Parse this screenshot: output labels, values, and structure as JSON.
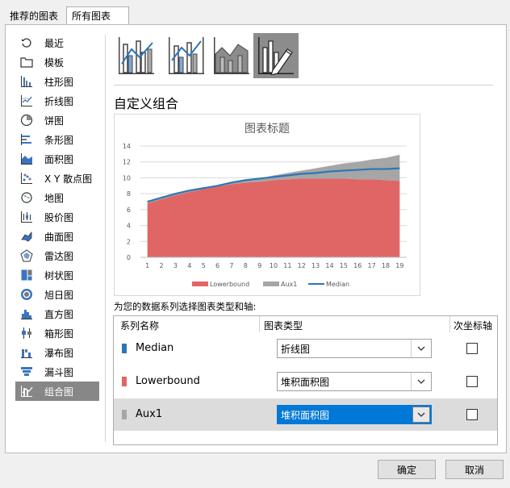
{
  "tabs": [
    {
      "label": "推荐的图表"
    },
    {
      "label": "所有图表"
    }
  ],
  "sidebar": {
    "items": [
      {
        "label": "最近",
        "icon": "recent-icon"
      },
      {
        "label": "模板",
        "icon": "folder-icon"
      },
      {
        "label": "柱形图",
        "icon": "column-chart-icon"
      },
      {
        "label": "折线图",
        "icon": "line-chart-icon"
      },
      {
        "label": "饼图",
        "icon": "pie-chart-icon"
      },
      {
        "label": "条形图",
        "icon": "bar-chart-icon"
      },
      {
        "label": "面积图",
        "icon": "area-chart-icon"
      },
      {
        "label": "X Y 散点图",
        "icon": "scatter-chart-icon"
      },
      {
        "label": "地图",
        "icon": "map-chart-icon"
      },
      {
        "label": "股价图",
        "icon": "stock-chart-icon"
      },
      {
        "label": "曲面图",
        "icon": "surface-chart-icon"
      },
      {
        "label": "雷达图",
        "icon": "radar-chart-icon"
      },
      {
        "label": "树状图",
        "icon": "treemap-chart-icon"
      },
      {
        "label": "旭日图",
        "icon": "sunburst-chart-icon"
      },
      {
        "label": "直方图",
        "icon": "histogram-chart-icon"
      },
      {
        "label": "箱形图",
        "icon": "box-whisker-chart-icon"
      },
      {
        "label": "瀑布图",
        "icon": "waterfall-chart-icon"
      },
      {
        "label": "漏斗图",
        "icon": "funnel-chart-icon"
      },
      {
        "label": "组合图",
        "icon": "combo-chart-icon"
      }
    ],
    "selected_index": 18
  },
  "section_title": "自定义组合",
  "chart_data": {
    "type": "area",
    "title": "图表标题",
    "x": [
      1,
      2,
      3,
      4,
      5,
      6,
      7,
      8,
      9,
      10,
      11,
      12,
      13,
      14,
      15,
      16,
      17,
      18,
      19
    ],
    "ylim": [
      0,
      14
    ],
    "yticks": [
      "0",
      "2",
      "4",
      "6",
      "8",
      "10",
      "12",
      "14"
    ],
    "grid": true,
    "legend_position": "bottom",
    "series": [
      {
        "name": "Lowerbound",
        "type": "stacked-area",
        "color": "#e06666",
        "values": [
          6.8,
          7.3,
          7.8,
          8.2,
          8.6,
          8.9,
          9.2,
          9.4,
          9.5,
          9.7,
          9.8,
          9.9,
          9.9,
          9.9,
          9.9,
          9.8,
          9.8,
          9.7,
          9.6
        ]
      },
      {
        "name": "Aux1",
        "type": "stacked-area",
        "color": "#a6a6a6",
        "values": [
          0.2,
          0.2,
          0.2,
          0.2,
          0.1,
          0.1,
          0.2,
          0.3,
          0.4,
          0.6,
          0.8,
          1.0,
          1.3,
          1.6,
          1.9,
          2.2,
          2.5,
          2.8,
          3.3
        ]
      },
      {
        "name": "Median",
        "type": "line",
        "color": "#2e75b6",
        "values": [
          7.0,
          7.5,
          8.0,
          8.4,
          8.7,
          9.0,
          9.4,
          9.7,
          9.9,
          10.1,
          10.3,
          10.5,
          10.6,
          10.8,
          10.9,
          11.0,
          11.1,
          11.1,
          11.2
        ]
      }
    ]
  },
  "prompt": "为您的数据系列选择图表类型和轴:",
  "grid": {
    "headers": {
      "series": "系列名称",
      "type": "图表类型",
      "axis": "次坐标轴"
    },
    "rows": [
      {
        "name": "Median",
        "color": "#2e75b6",
        "type": "折线图",
        "secondary": false
      },
      {
        "name": "Lowerbound",
        "color": "#e06666",
        "type": "堆积面积图",
        "secondary": false
      },
      {
        "name": "Aux1",
        "color": "#a6a6a6",
        "type": "堆积面积图",
        "secondary": false
      }
    ]
  },
  "buttons": {
    "ok": "确定",
    "cancel": "取消"
  }
}
